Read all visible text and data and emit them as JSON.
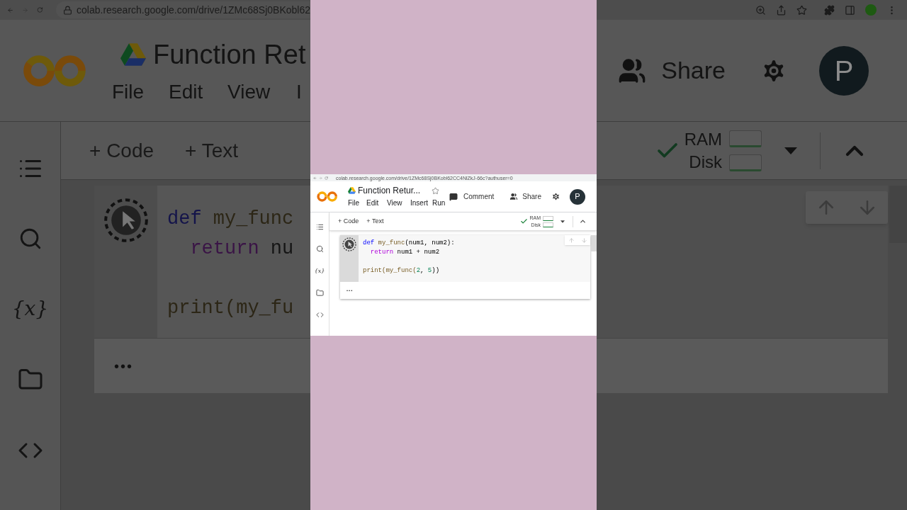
{
  "background_left": {
    "browser_url": "colab.research.google.com/drive/1ZMc68Sj0BKobl62",
    "notebook_title": "Function Ret",
    "menu": [
      "File",
      "Edit",
      "View",
      "I"
    ],
    "add_buttons": [
      "+ Code",
      "+ Text"
    ],
    "variables_label": "{x}",
    "code_lines": [
      {
        "kind": "code",
        "tokens": [
          {
            "text": "def",
            "kind": "keyword"
          },
          {
            "text": " my_func",
            "kind": "function"
          }
        ]
      },
      {
        "kind": "code",
        "tokens": [
          {
            "text": "  return",
            "kind": "control"
          },
          {
            "text": " nu",
            "kind": "plain"
          }
        ]
      },
      {
        "kind": "blank"
      },
      {
        "kind": "code",
        "tokens": [
          {
            "text": "print(my_fu",
            "kind": "function"
          }
        ]
      }
    ],
    "output_ellipsis": "•••"
  },
  "background_right": {
    "share_label": "Share",
    "avatar_letter": "P",
    "ram_label": "RAM",
    "disk_label": "Disk"
  },
  "video_frame": {
    "browser_url": "colab.research.google.com/drive/1ZMc68Sj0BKobl62CC4NlZkJ-66c?authuser=0",
    "notebook_title": "Function Retur...",
    "menu": [
      "File",
      "Edit",
      "View",
      "Insert",
      "Run"
    ],
    "comment_label": "Comment",
    "share_label": "Share",
    "avatar_letter": "P",
    "add_buttons": [
      "+ Code",
      "+ Text"
    ],
    "variables_label": "{x}",
    "ram_label": "RAM",
    "disk_label": "Disk",
    "code_lines": [
      {
        "kind": "code",
        "tokens": [
          {
            "text": "def",
            "kind": "keyword"
          },
          {
            "text": " my_func",
            "kind": "function"
          },
          {
            "text": "(num1, num2):",
            "kind": "plain"
          }
        ]
      },
      {
        "kind": "code",
        "tokens": [
          {
            "text": "  return",
            "kind": "control"
          },
          {
            "text": " num1 + num2",
            "kind": "plain"
          }
        ]
      },
      {
        "kind": "blank"
      },
      {
        "kind": "code",
        "tokens": [
          {
            "text": "print(my_func(",
            "kind": "function"
          },
          {
            "text": "2",
            "kind": "number"
          },
          {
            "text": ", ",
            "kind": "plain"
          },
          {
            "text": "5",
            "kind": "number"
          },
          {
            "text": "))",
            "kind": "plain"
          }
        ]
      }
    ],
    "output_ellipsis": "•••"
  }
}
